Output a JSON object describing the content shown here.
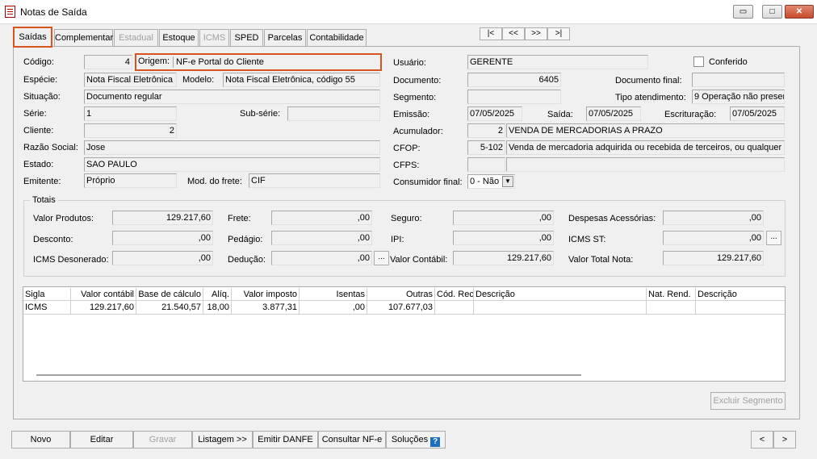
{
  "window": {
    "title": "Notas de Saída",
    "minimize": "▭",
    "maximize": "□",
    "close": "✕"
  },
  "tabs": [
    "Saídas",
    "Complementar",
    "Estadual",
    "Estoque",
    "ICMS",
    "SPED",
    "Parcelas",
    "Contabilidade"
  ],
  "nav": {
    "first": "|<",
    "prev": "<<",
    "next": ">>",
    "last": ">|"
  },
  "form": {
    "codigo_label": "Código:",
    "codigo": "4",
    "origem_label": "Origem:",
    "origem": "NF-e Portal do Cliente",
    "especie_label": "Espécie:",
    "especie": "Nota Fiscal Eletrônica",
    "modelo_label": "Modelo:",
    "modelo": "Nota Fiscal Eletrônica, código 55",
    "situacao_label": "Situação:",
    "situacao": "Documento regular",
    "serie_label": "Série:",
    "serie": "1",
    "subserie_label": "Sub-série:",
    "subserie": "",
    "cliente_label": "Cliente:",
    "cliente": "2",
    "razao_label": "Razão Social:",
    "razao": "Jose",
    "estado_label": "Estado:",
    "estado": "SAO PAULO",
    "emitente_label": "Emitente:",
    "emitente": "Próprio",
    "frete_label": "Mod. do frete:",
    "frete": "CIF",
    "usuario_label": "Usuário:",
    "usuario": "GERENTE",
    "conferido_label": "Conferido",
    "documento_label": "Documento:",
    "documento": "6405",
    "docfinal_label": "Documento final:",
    "docfinal": "",
    "segmento_label": "Segmento:",
    "segmento": "",
    "tipoatend_label": "Tipo atendimento:",
    "tipoatend": "9 Operação não presen",
    "emissao_label": "Emissão:",
    "emissao": "07/05/2025",
    "saida_label": "Saída:",
    "saida": "07/05/2025",
    "escrit_label": "Escrituração:",
    "escrit": "07/05/2025",
    "acum_label": "Acumulador:",
    "acum_code": "2",
    "acum_desc": "VENDA DE MERCADORIAS A PRAZO",
    "cfop_label": "CFOP:",
    "cfop_code": "5-102",
    "cfop_desc": "Venda de mercadoria adquirida ou recebida de terceiros, ou qualquer ve",
    "cfps_label": "CFPS:",
    "cfps_code": "",
    "cfps_desc": "",
    "consumidor_label": "Consumidor final:",
    "consumidor": "0 - Não"
  },
  "totais": {
    "legend": "Totais",
    "valor_produtos_label": "Valor Produtos:",
    "valor_produtos": "129.217,60",
    "frete_label": "Frete:",
    "frete": ",00",
    "seguro_label": "Seguro:",
    "seguro": ",00",
    "despesas_label": "Despesas Acessórias:",
    "despesas": ",00",
    "desconto_label": "Desconto:",
    "desconto": ",00",
    "pedagio_label": "Pedágio:",
    "pedagio": ",00",
    "ipi_label": "IPI:",
    "ipi": ",00",
    "icmsst_label": "ICMS ST:",
    "icmsst": ",00",
    "icmsdes_label": "ICMS Desonerado:",
    "icmsdes": ",00",
    "deducao_label": "Dedução:",
    "deducao": ",00",
    "valorcontabil_label": "Valor Contábil:",
    "valorcontabil": "129.217,60",
    "valortotal_label": "Valor Total Nota:",
    "valortotal": "129.217,60",
    "ellipsis": "..."
  },
  "grid": {
    "headers": [
      "Sigla",
      "Valor contábil",
      "Base de cálculo",
      "Alíq.",
      "Valor imposto",
      "Isentas",
      "Outras",
      "Cód. Rec.",
      "Descrição",
      "Nat. Rend.",
      "Descrição"
    ],
    "row": [
      "ICMS",
      "129.217,60",
      "21.540,57",
      "18,00",
      "3.877,31",
      ",00",
      "107.677,03",
      "",
      "",
      "",
      ""
    ]
  },
  "excluir_segmento": "Excluir Segmento",
  "buttons": {
    "novo": "Novo",
    "editar": "Editar",
    "gravar": "Gravar",
    "listagem": "Listagem >>",
    "emitir": "Emitir DANFE",
    "consultar": "Consultar NF-e",
    "solucoes": "Soluções",
    "help": "?",
    "prev": "<",
    "next": ">"
  }
}
